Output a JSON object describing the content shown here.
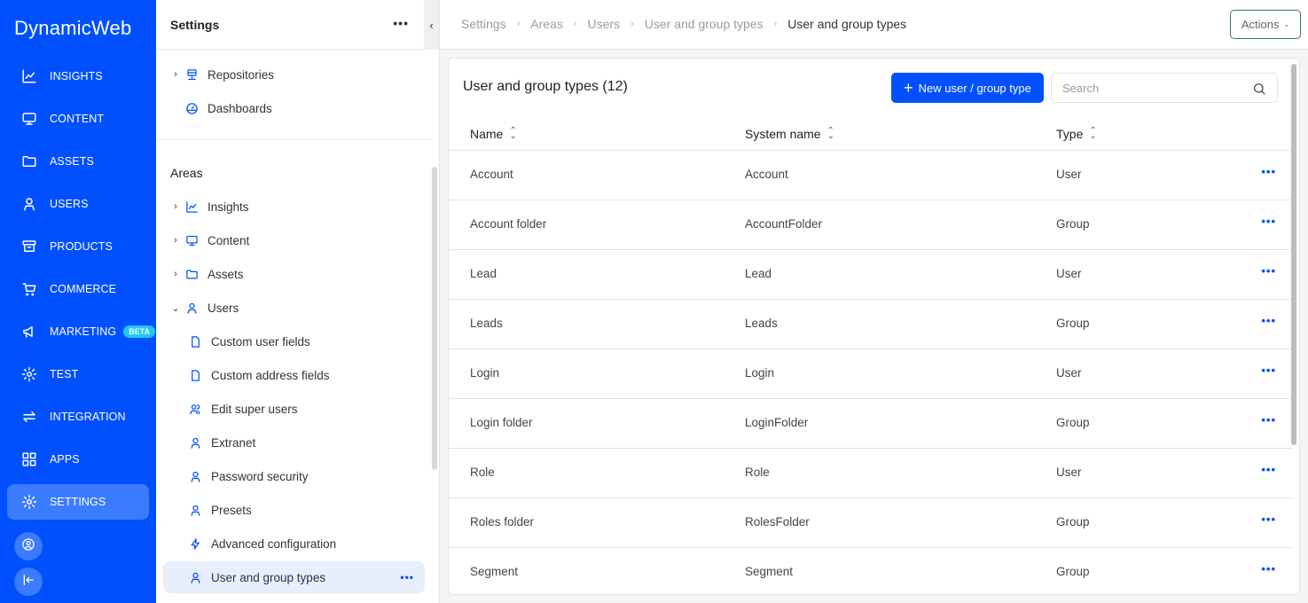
{
  "app": {
    "logo": "DynamicWeb",
    "brand_color": "#0050ff"
  },
  "nav": {
    "items": [
      {
        "label": "INSIGHTS",
        "icon": "chart-line-icon"
      },
      {
        "label": "CONTENT",
        "icon": "monitor-icon"
      },
      {
        "label": "ASSETS",
        "icon": "folder-icon"
      },
      {
        "label": "USERS",
        "icon": "user-icon"
      },
      {
        "label": "PRODUCTS",
        "icon": "archive-icon"
      },
      {
        "label": "COMMERCE",
        "icon": "cart-icon"
      },
      {
        "label": "MARKETING",
        "icon": "megaphone-icon",
        "badge": "BETA"
      },
      {
        "label": "TEST",
        "icon": "gear-icon"
      },
      {
        "label": "INTEGRATION",
        "icon": "arrows-exchange-icon"
      },
      {
        "label": "APPS",
        "icon": "grid-icon"
      },
      {
        "label": "SETTINGS",
        "icon": "gear-icon",
        "active": true
      }
    ],
    "profile_icon": "user-circle-icon",
    "collapse_icon": "collapse-left-icon"
  },
  "side": {
    "title": "Settings",
    "more": "•••",
    "collapse": "‹",
    "top_items": [
      {
        "label": "Repositories",
        "icon": "server-icon",
        "expandable": true
      },
      {
        "label": "Dashboards",
        "icon": "dashboard-icon",
        "expandable": false
      }
    ],
    "areas_label": "Areas",
    "areas": [
      {
        "label": "Insights",
        "icon": "chart-line-icon",
        "chevron": "›"
      },
      {
        "label": "Content",
        "icon": "monitor-icon",
        "chevron": "›"
      },
      {
        "label": "Assets",
        "icon": "folder-icon",
        "chevron": "›"
      },
      {
        "label": "Users",
        "icon": "user-icon",
        "chevron": "⌄"
      }
    ],
    "user_children": [
      {
        "label": "Custom user fields",
        "icon": "file-icon"
      },
      {
        "label": "Custom address fields",
        "icon": "file-icon"
      },
      {
        "label": "Edit super users",
        "icon": "users-icon"
      },
      {
        "label": "Extranet",
        "icon": "user-icon"
      },
      {
        "label": "Password security",
        "icon": "user-icon"
      },
      {
        "label": "Presets",
        "icon": "user-icon"
      },
      {
        "label": "Advanced configuration",
        "icon": "lightning-icon"
      },
      {
        "label": "User and group types",
        "icon": "user-icon",
        "selected": true,
        "more": "•••"
      }
    ]
  },
  "breadcrumb": [
    "Settings",
    "Areas",
    "Users",
    "User and group types",
    "User and group types"
  ],
  "breadcrumb_sep": "›",
  "actions": {
    "label": "Actions",
    "caret": "⌄"
  },
  "panel": {
    "title": "User and group types (12)",
    "new_button": {
      "plus": "+",
      "label": "New user / group type"
    },
    "search": {
      "placeholder": "Search",
      "value": ""
    },
    "columns": [
      "Name",
      "System name",
      "Type"
    ],
    "sort_glyph_up": "⌃",
    "sort_glyph_down": "⌄",
    "row_more": "•••",
    "rows": [
      {
        "name": "Account",
        "system_name": "Account",
        "type": "User"
      },
      {
        "name": "Account folder",
        "system_name": "AccountFolder",
        "type": "Group"
      },
      {
        "name": "Lead",
        "system_name": "Lead",
        "type": "User"
      },
      {
        "name": "Leads",
        "system_name": "Leads",
        "type": "Group"
      },
      {
        "name": "Login",
        "system_name": "Login",
        "type": "User"
      },
      {
        "name": "Login folder",
        "system_name": "LoginFolder",
        "type": "Group"
      },
      {
        "name": "Role",
        "system_name": "Role",
        "type": "User"
      },
      {
        "name": "Roles folder",
        "system_name": "RolesFolder",
        "type": "Group"
      },
      {
        "name": "Segment",
        "system_name": "Segment",
        "type": "Group"
      }
    ]
  }
}
